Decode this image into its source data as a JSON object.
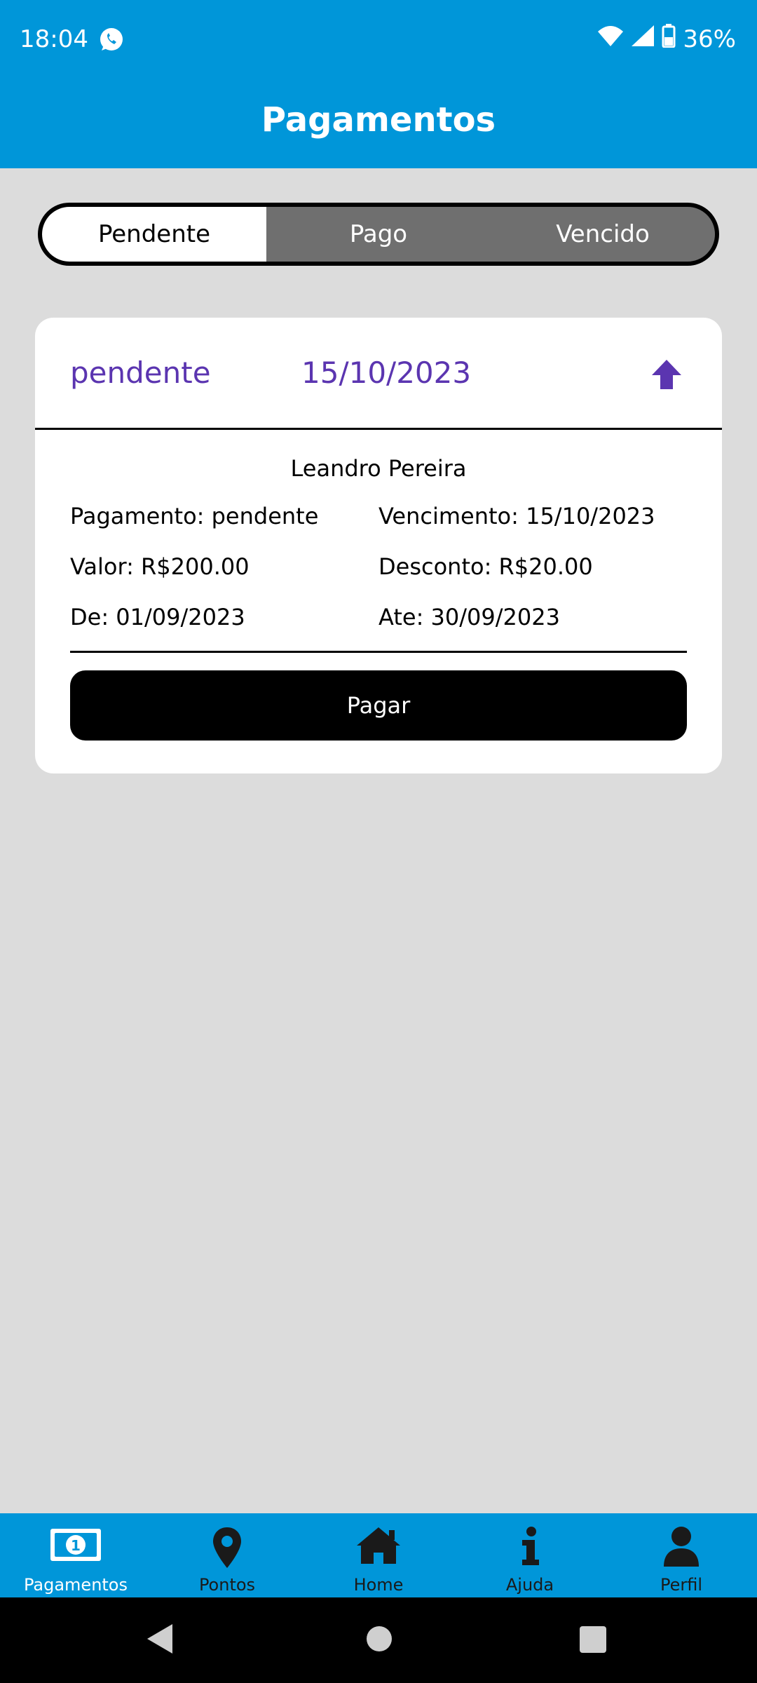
{
  "status_bar": {
    "time": "18:04",
    "battery": "36%",
    "icons": [
      "whatsapp-icon",
      "wifi-icon",
      "signal-icon",
      "battery-icon"
    ]
  },
  "app_bar": {
    "title": "Pagamentos"
  },
  "tabs": [
    {
      "label": "Pendente",
      "selected": true
    },
    {
      "label": "Pago",
      "selected": false
    },
    {
      "label": "Vencido",
      "selected": false
    }
  ],
  "payment_card": {
    "header_status": "pendente",
    "header_date": "15/10/2023",
    "collapse_icon": "arrow-up-icon",
    "customer_name": "Leandro Pereira",
    "fields": {
      "pagamento": "Pagamento: pendente",
      "vencimento": "Vencimento: 15/10/2023",
      "valor": "Valor: R$200.00",
      "desconto": "Desconto: R$20.00",
      "de": "De: 01/09/2023",
      "ate": "Ate: 30/09/2023"
    },
    "pay_button": "Pagar"
  },
  "bottom_nav": [
    {
      "label": "Pagamentos",
      "icon": "money-bill-icon",
      "active": true
    },
    {
      "label": "Pontos",
      "icon": "map-pin-icon",
      "active": false
    },
    {
      "label": "Home",
      "icon": "home-icon",
      "active": false
    },
    {
      "label": "Ajuda",
      "icon": "info-icon",
      "active": false
    },
    {
      "label": "Perfil",
      "icon": "user-icon",
      "active": false
    }
  ],
  "colors": {
    "primary": "#0096d9",
    "background": "#dcdcdc",
    "accent_purple": "#5b35b0",
    "segment_inactive": "#6f6f6f"
  }
}
